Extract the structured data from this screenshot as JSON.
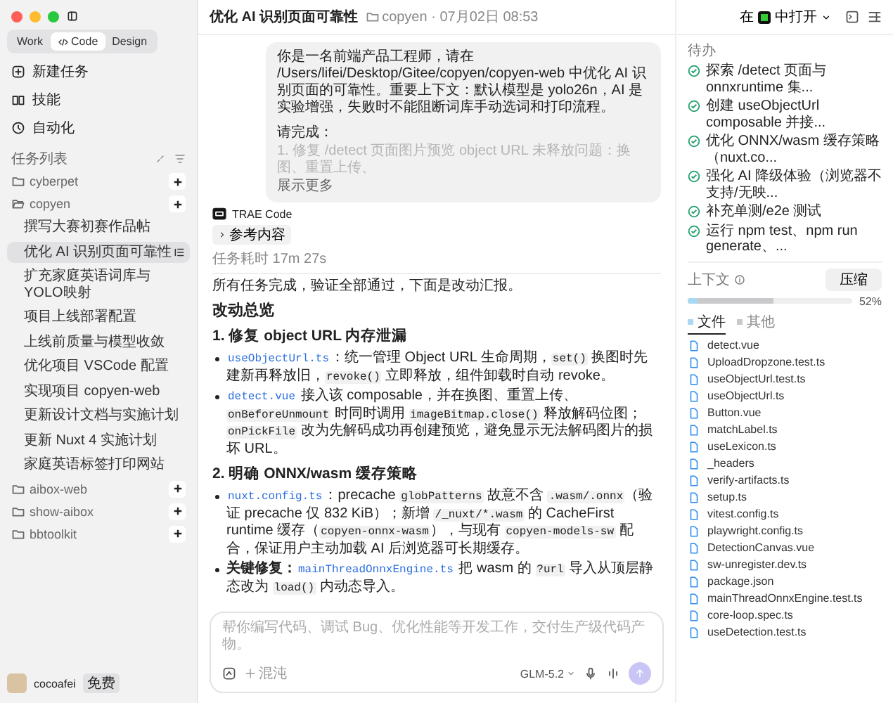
{
  "sidebar": {
    "modes": [
      {
        "label": "Work",
        "selected": false
      },
      {
        "label": "Code",
        "selected": true
      },
      {
        "label": "Design",
        "selected": false
      }
    ],
    "nav": [
      "新建任务",
      "技能",
      "自动化"
    ],
    "task_list_title": "任务列表",
    "projects": [
      {
        "name": "cyberpet",
        "expanded": false
      },
      {
        "name": "copyen",
        "expanded": true,
        "children": [
          {
            "label": "撰写大赛初赛作品帖",
            "selected": false
          },
          {
            "label": "优化 AI 识别页面可靠性",
            "selected": true
          },
          {
            "label": "扩充家庭英语词库与YOLO映射",
            "selected": false
          },
          {
            "label": "项目上线部署配置",
            "selected": false
          },
          {
            "label": "上线前质量与模型收敛",
            "selected": false
          },
          {
            "label": "优化项目 VSCode 配置",
            "selected": false
          },
          {
            "label": "实现项目 copyen-web",
            "selected": false
          },
          {
            "label": "更新设计文档与实施计划",
            "selected": false
          },
          {
            "label": "更新 Nuxt 4 实施计划",
            "selected": false
          },
          {
            "label": "家庭英语标签打印网站",
            "selected": false
          }
        ]
      },
      {
        "name": "aibox-web",
        "expanded": false
      },
      {
        "name": "show-aibox",
        "expanded": false
      },
      {
        "name": "bbtoolkit",
        "expanded": false
      }
    ],
    "user": {
      "name": "cocoafei",
      "badge": "免费"
    }
  },
  "header": {
    "title": "优化 AI 识别页面可靠性",
    "meta": "copyen · 07月02日 08:53",
    "open_prefix": "在",
    "open_suffix": "中打开"
  },
  "chat": {
    "user_message": {
      "text": "你是一名前端产品工程师，请在 /Users/lifei/Desktop/Gitee/copyen/copyen-web 中优化 AI 识别页面的可靠性。重要上下文：默认模型是 yolo26n，AI 是实验增强，失败时不能阻断词库手动选词和打印流程。",
      "request": "请完成：",
      "faded": "1. 修复 /detect 页面图片预览 object URL 未释放问题：换图、重置上传、",
      "more": "展示更多"
    },
    "agent": "TRAE Code",
    "reference": "参考内容",
    "duration": "任务耗时 17m 27s",
    "summary": "所有任务完成，验证全部通过，下面是改动汇报。",
    "heading": "改动总览",
    "sections": [
      {
        "title": "1. 修复 object URL 内存泄漏",
        "bullets": [
          [
            {
              "kind": "file",
              "text": "useObjectUrl.ts"
            },
            {
              "kind": "text",
              "text": "：统一管理 Object URL 生命周期，"
            },
            {
              "kind": "code",
              "text": "set()"
            },
            {
              "kind": "text",
              "text": " 换图时先建新再释放旧，"
            },
            {
              "kind": "code",
              "text": "revoke()"
            },
            {
              "kind": "text",
              "text": " 立即释放，组件卸载时自动 revoke。"
            }
          ],
          [
            {
              "kind": "file",
              "text": "detect.vue"
            },
            {
              "kind": "text",
              "text": " 接入该 composable，并在换图、重置上传、"
            },
            {
              "kind": "code",
              "text": "onBeforeUnmount"
            },
            {
              "kind": "text",
              "text": " 时同时调用 "
            },
            {
              "kind": "code",
              "text": "imageBitmap.close()"
            },
            {
              "kind": "text",
              "text": " 释放解码位图；"
            },
            {
              "kind": "code",
              "text": "onPickFile"
            },
            {
              "kind": "text",
              "text": " 改为先解码成功再创建预览，避免显示无法解码图片的损坏 URL。"
            }
          ]
        ]
      },
      {
        "title": "2. 明确 ONNX/wasm 缓存策略",
        "bullets": [
          [
            {
              "kind": "file",
              "text": "nuxt.config.ts"
            },
            {
              "kind": "text",
              "text": "：precache "
            },
            {
              "kind": "code",
              "text": "globPatterns"
            },
            {
              "kind": "text",
              "text": " 故意不含 "
            },
            {
              "kind": "code",
              "text": ".wasm/.onnx"
            },
            {
              "kind": "text",
              "text": "（验证 precache 仅 832 KiB）；新增 "
            },
            {
              "kind": "code",
              "text": "/_nuxt/*.wasm"
            },
            {
              "kind": "text",
              "text": " 的 CacheFirst runtime 缓存（"
            },
            {
              "kind": "code",
              "text": "copyen-onnx-wasm"
            },
            {
              "kind": "text",
              "text": "），与现有 "
            },
            {
              "kind": "code",
              "text": "copyen-models-sw"
            },
            {
              "kind": "text",
              "text": " 配合，保证用户主动加载 AI 后浏览器可长期缓存。"
            }
          ],
          [
            {
              "kind": "bold",
              "text": "关键修复："
            },
            {
              "kind": "file",
              "text": "mainThreadOnnxEngine.ts"
            },
            {
              "kind": "text",
              "text": " 把 wasm 的 "
            },
            {
              "kind": "code",
              "text": "?url"
            },
            {
              "kind": "text",
              "text": " 导入从顶层静态改为 "
            },
            {
              "kind": "code",
              "text": "load()"
            },
            {
              "kind": "text",
              "text": " 内动态导入。"
            }
          ]
        ]
      }
    ]
  },
  "composer": {
    "placeholder": "帮你编写代码、调试 Bug、优化性能等开发工作，交付生产级代码产物。",
    "mode": "混沌",
    "model": "GLM-5.2"
  },
  "todo": {
    "title": "待办",
    "items": [
      {
        "text": "探索 /detect 页面与 onnxruntime 集...",
        "done": true
      },
      {
        "text": "创建 useObjectUrl composable 并接...",
        "done": true
      },
      {
        "text": "优化 ONNX/wasm 缓存策略（nuxt.co...",
        "done": true
      },
      {
        "text": "强化 AI 降级体验（浏览器不支持/无映...",
        "done": true
      },
      {
        "text": "补充单测/e2e 测试",
        "done": true
      },
      {
        "text": "运行 npm test、npm run generate、...",
        "done": true
      }
    ]
  },
  "context": {
    "title": "上下文",
    "compress": "压缩",
    "reading": "52%",
    "level": 0.52,
    "segments": [
      {
        "label": "文件",
        "level": 0.06,
        "color": "#a9d9f2",
        "selected": true
      },
      {
        "label": "其他",
        "color": "#c9c9cc",
        "selected": false
      }
    ]
  },
  "files": [
    "detect.vue",
    "UploadDropzone.test.ts",
    "useObjectUrl.test.ts",
    "useObjectUrl.ts",
    "Button.vue",
    "matchLabel.ts",
    "useLexicon.ts",
    "_headers",
    "verify-artifacts.ts",
    "setup.ts",
    "vitest.config.ts",
    "playwright.config.ts",
    "DetectionCanvas.vue",
    "sw-unregister.dev.ts",
    "package.json",
    "mainThreadOnnxEngine.test.ts",
    "core-loop.spec.ts",
    "useDetection.test.ts"
  ]
}
